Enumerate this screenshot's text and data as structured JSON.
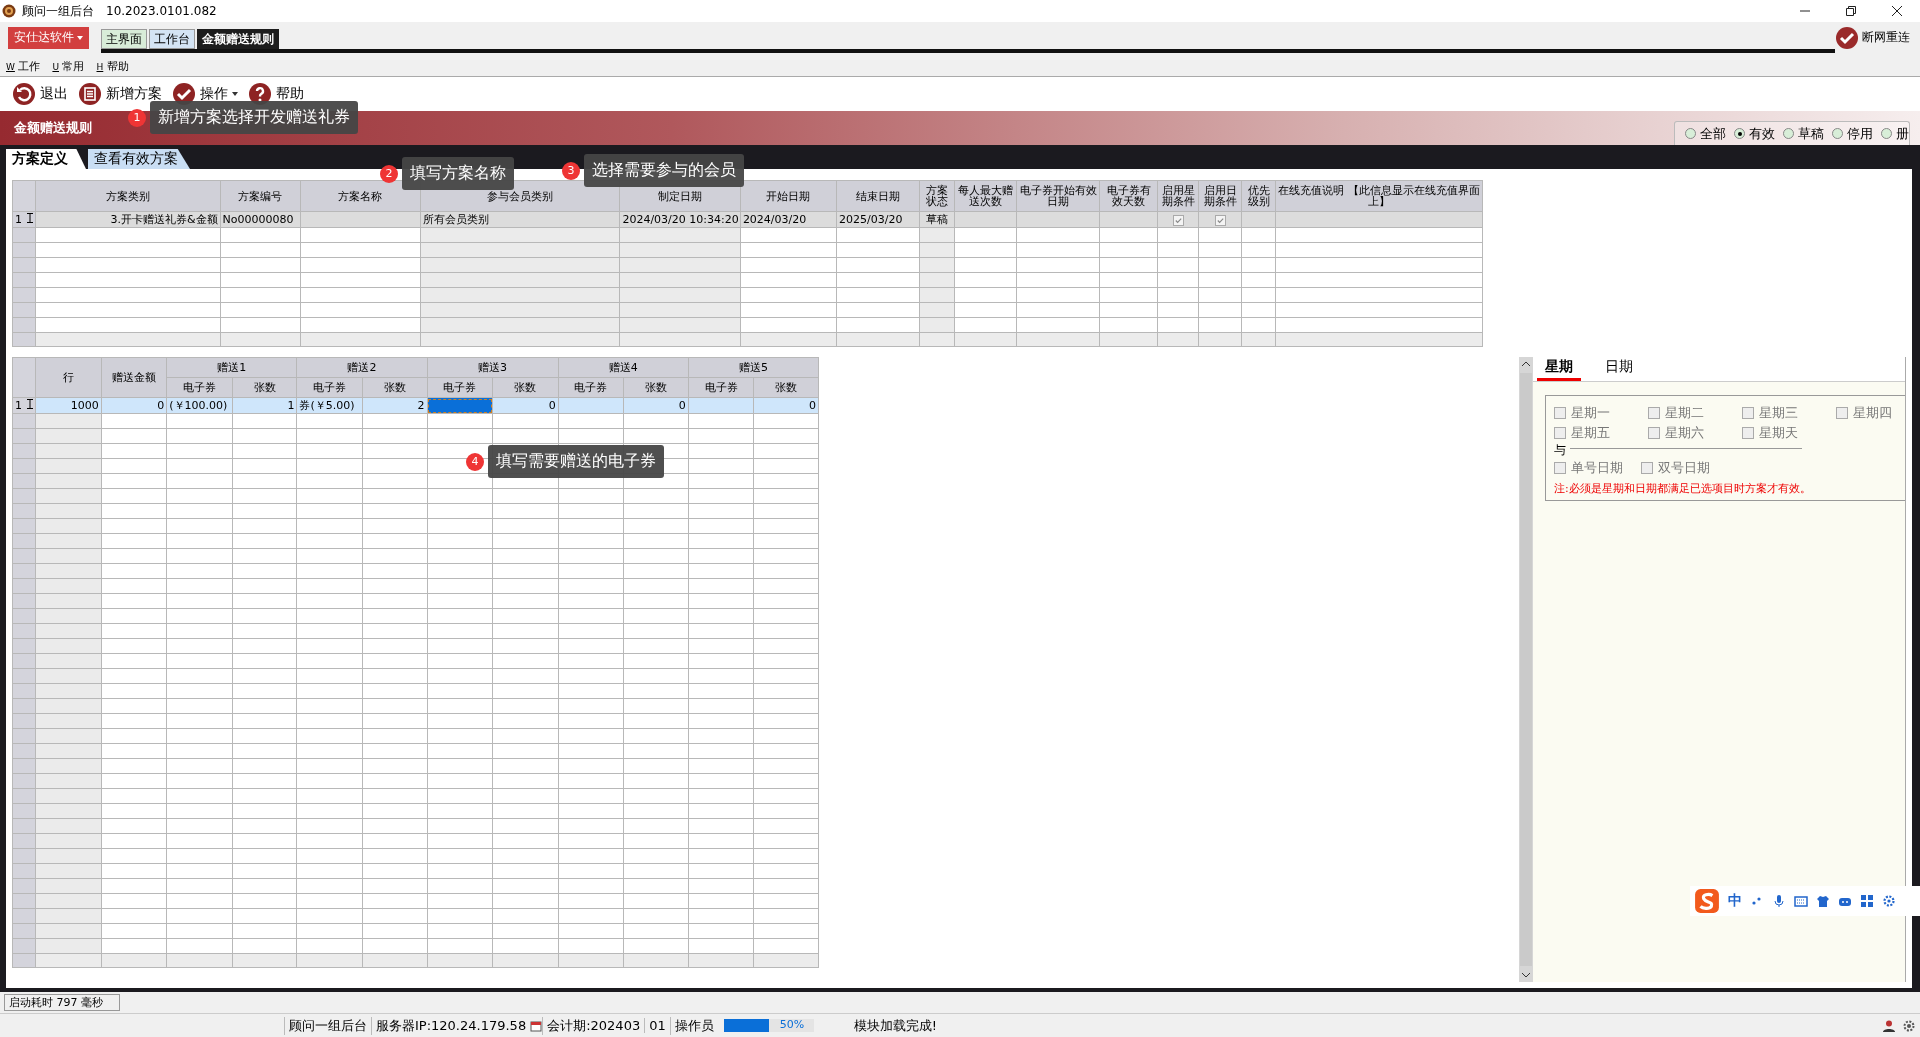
{
  "window": {
    "title": "顾问一组后台",
    "version": "10.2023.0101.082"
  },
  "brand_menu": {
    "label": "安仕达软件"
  },
  "app_tabs": [
    {
      "label": "主界面",
      "selected": false
    },
    {
      "label": "工作台",
      "selected": false
    },
    {
      "label": "金额赠送规则",
      "selected": true
    }
  ],
  "reconnect": {
    "label": "断网重连"
  },
  "menu": [
    {
      "key": "W",
      "label": "工作"
    },
    {
      "key": "U",
      "label": "常用"
    },
    {
      "key": "H",
      "label": "帮助"
    }
  ],
  "toolbar": [
    {
      "kind": "exit",
      "label": "退出"
    },
    {
      "kind": "add",
      "label": "新增方案"
    },
    {
      "kind": "ops",
      "label": "操作"
    },
    {
      "kind": "help",
      "label": "帮助"
    }
  ],
  "banner": {
    "title": "金额赠送规则"
  },
  "filters": [
    {
      "label": "全部",
      "selected": false
    },
    {
      "label": "有效",
      "selected": true
    },
    {
      "label": "草稿",
      "selected": false
    },
    {
      "label": "停用",
      "selected": false
    },
    {
      "label": "册",
      "selected": false
    }
  ],
  "content_tabs": [
    {
      "label": "方案定义",
      "selected": true
    },
    {
      "label": "查看有效方案",
      "selected": false
    }
  ],
  "callouts": [
    {
      "number": "1",
      "text": "新增方案选择开发赠送礼券"
    },
    {
      "number": "2",
      "text": "填写方案名称"
    },
    {
      "number": "3",
      "text": "选择需要参与的会员"
    },
    {
      "number": "4",
      "text": "填写需要赠送的电子券"
    }
  ],
  "plans_table": {
    "columns": [
      "方案类别",
      "方案编号",
      "方案名称",
      "参与会员类别",
      "制定日期",
      "开始日期",
      "结束日期",
      "方案状态",
      "每人最大赠送次数",
      "电子券开始有效日期",
      "电子券有效天数",
      "启用星期条件",
      "启用日期条件",
      "优先级别",
      "在线充值说明 【此信息显示在线充值界面上】"
    ],
    "rows": [
      {
        "row_number": "1",
        "category": "3.开卡赠送礼券&金额",
        "code": "No00000080",
        "member_type": "所有会员类别",
        "created": "2024/03/20 10:34:20",
        "start": "2024/03/20",
        "end": "2025/03/20",
        "status": "草稿",
        "week_condition": true,
        "date_condition": true
      }
    ]
  },
  "gift_table": {
    "columns": [
      "行",
      "赠送金额"
    ],
    "groups": [
      {
        "label": "赠送1",
        "sub": [
          "电子券",
          "张数"
        ]
      },
      {
        "label": "赠送2",
        "sub": [
          "电子券",
          "张数"
        ]
      },
      {
        "label": "赠送3",
        "sub": [
          "电子券",
          "张数"
        ]
      },
      {
        "label": "赠送4",
        "sub": [
          "电子券",
          "张数"
        ]
      },
      {
        "label": "赠送5",
        "sub": [
          "电子券",
          "张数"
        ]
      }
    ],
    "rows": [
      {
        "row_number": "1",
        "cells": [
          {
            "text": "1000",
            "focused": false
          },
          {
            "text": "0",
            "focused": false
          },
          {
            "text": "(￥100.00)",
            "focused": false
          },
          {
            "text": "1",
            "focused": false
          },
          {
            "text": "券(￥5.00)",
            "focused": false
          },
          {
            "text": "2",
            "focused": false
          },
          {
            "focused": true
          },
          {
            "text": "0",
            "focused": false
          },
          {
            "focused": false
          },
          {
            "text": "0",
            "focused": false
          },
          {
            "focused": false
          },
          {
            "text": "0",
            "focused": false
          }
        ]
      }
    ]
  },
  "condition_panel": {
    "tabs": [
      {
        "label": "星期",
        "selected": true
      },
      {
        "label": "日期",
        "selected": false
      }
    ],
    "weekdays": [
      {
        "label": "星期一",
        "checked": false
      },
      {
        "label": "星期二",
        "checked": false
      },
      {
        "label": "星期三",
        "checked": false
      },
      {
        "label": "星期四",
        "checked": false
      },
      {
        "label": "星期五",
        "checked": false
      },
      {
        "label": "星期六",
        "checked": false
      },
      {
        "label": "星期天",
        "checked": false
      }
    ],
    "conjunction": "与",
    "date_options": [
      {
        "label": "单号日期",
        "checked": false
      },
      {
        "label": "双号日期",
        "checked": false
      }
    ],
    "note": "注:必须是星期和日期都满足已选项目时方案才有效。"
  },
  "ime_bar": {
    "mode": "中"
  },
  "status_bar": {
    "startup": "启动耗时 797 毫秒",
    "app": "顾问一组后台",
    "server": "服务器IP:120.24.179.58",
    "period": "会计期:202403",
    "operator_code": "01",
    "operator": "操作员",
    "progress": {
      "level": 0.5,
      "label": "50%"
    },
    "message": "模块加载完成!"
  }
}
